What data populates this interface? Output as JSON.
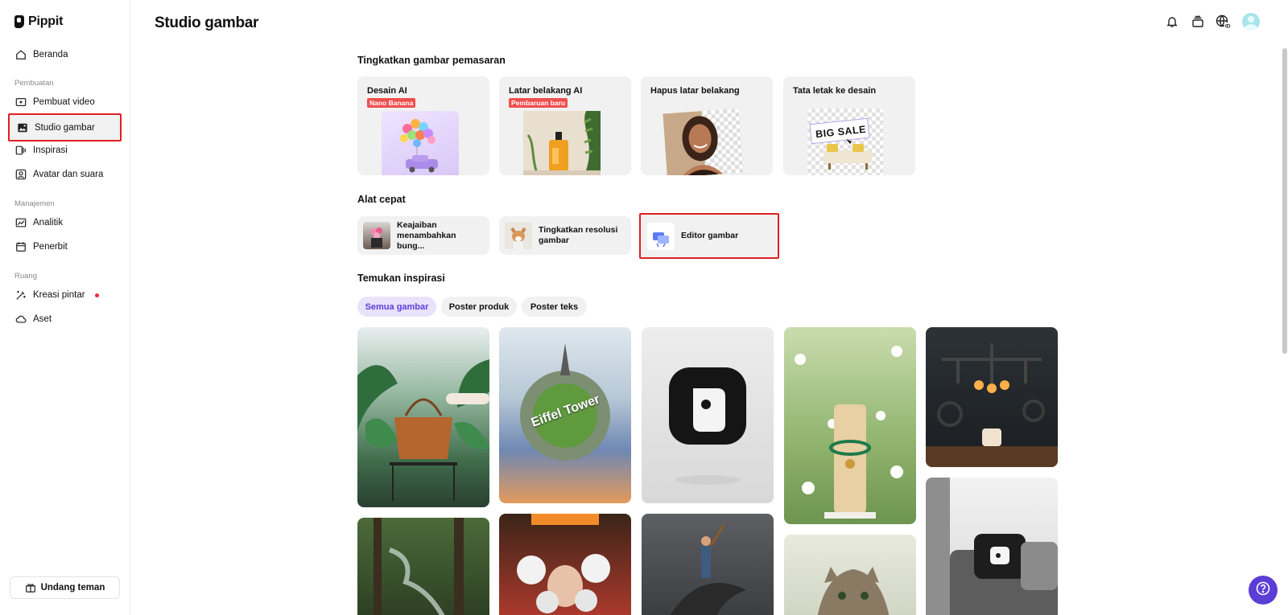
{
  "app": {
    "name": "Pippit"
  },
  "sidebar": {
    "home": "Beranda",
    "sections": {
      "creation": "Pembuatan",
      "management": "Manajemen",
      "space": "Ruang"
    },
    "creation_items": [
      "Pembuat video",
      "Studio gambar",
      "Inspirasi",
      "Avatar dan suara"
    ],
    "management_items": [
      "Analitik",
      "Penerbit"
    ],
    "space_items": [
      "Kreasi pintar",
      "Aset"
    ],
    "invite": "Undang teman"
  },
  "header": {
    "title": "Studio gambar"
  },
  "marketing": {
    "title": "Tingkatkan gambar pemasaran",
    "cards": [
      {
        "title": "Desain AI",
        "badge": "Nano Banana"
      },
      {
        "title": "Latar belakang AI",
        "badge": "Pembaruan baru"
      },
      {
        "title": "Hapus latar belakang"
      },
      {
        "title": "Tata letak ke desain",
        "image_text": "BIG SALE"
      }
    ]
  },
  "quick_tools": {
    "title": "Alat cepat",
    "items": [
      "Keajaiban menambahkan bung...",
      "Tingkatkan resolusi gambar",
      "Editor gambar"
    ]
  },
  "inspiration": {
    "title": "Temukan inspirasi",
    "filters": [
      "Semua gambar",
      "Poster produk",
      "Poster teks"
    ],
    "active_filter": "Semua gambar",
    "tile_texts": {
      "eiffel": "Eiffel Tower"
    }
  },
  "colors": {
    "accent": "#5a3ed6",
    "highlight": "#e02020",
    "badge": "#f04e4e"
  },
  "icons": [
    "bell-icon",
    "layers-icon",
    "globe-language-icon",
    "help-icon"
  ]
}
